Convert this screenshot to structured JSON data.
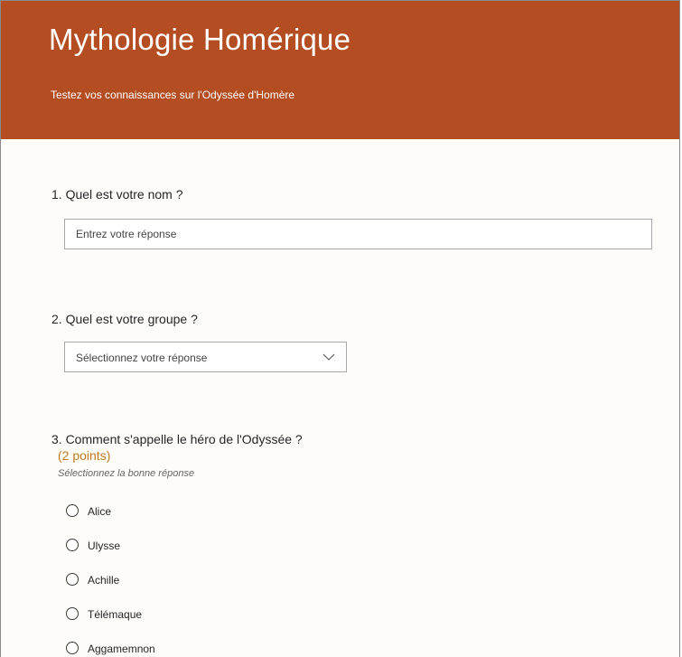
{
  "header": {
    "title": "Mythologie Homérique",
    "subtitle": "Testez vos connaissances sur l'Odyssée d'Homère",
    "background_color": "#b44e22"
  },
  "questions": [
    {
      "title": "1. Quel est votre nom ?",
      "placeholder": "Entrez votre réponse"
    },
    {
      "title": "2. Quel est votre groupe ?",
      "selected": "Sélectionnez votre réponse",
      "icon": "chevron-down-icon"
    },
    {
      "title": "3. Comment s'appelle le héro de l'Odyssée ?",
      "points": "(2 points)",
      "hint": "Sélectionnez la bonne réponse",
      "options": [
        {
          "label": "Alice"
        },
        {
          "label": "Ulysse"
        },
        {
          "label": "Achille"
        },
        {
          "label": "Télémaque"
        },
        {
          "label": "Aggamemnon"
        }
      ]
    }
  ],
  "colors": {
    "accent": "#b44e22",
    "points": "#c07a1c",
    "page_background": "#fdfcf9"
  }
}
